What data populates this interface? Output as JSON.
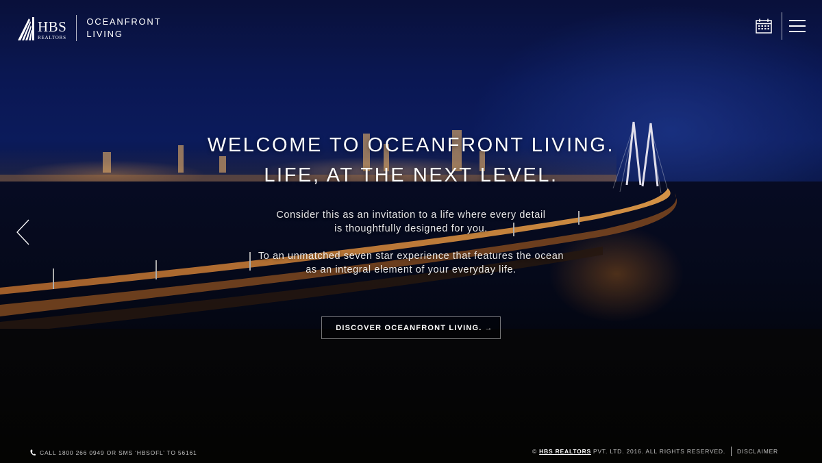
{
  "brand": {
    "logo_name": "HBS",
    "logo_sub": "REALTORS",
    "tagline_line1": "OCEANFRONT",
    "tagline_line2": "LIVING"
  },
  "header": {
    "calendar_icon": "calendar-icon",
    "menu_icon": "hamburger-menu-icon"
  },
  "hero": {
    "heading_line1": "WELCOME TO OCEANFRONT LIVING.",
    "heading_line2": "LIFE, AT THE NEXT LEVEL.",
    "para1_line1": "Consider this as an invitation to a life where every detail",
    "para1_line2": "is thoughtfully designed for you.",
    "para2_line1": "To an unmatched seven star experience that features the ocean",
    "para2_line2": "as an integral element of your everyday life.",
    "cta_label": "DISCOVER OCEANFRONT LIVING.",
    "cta_arrow": "→"
  },
  "carousel": {
    "prev_icon": "chevron-left-icon"
  },
  "footer": {
    "contact": "CALL 1800 266 0949 OR SMS ‘HBSOFL’ TO 56161",
    "copyright_prefix": "©",
    "copyright_brand": "HBS REALTORS",
    "copyright_suffix": "PVT. LTD. 2016. ALL RIGHTS RESERVED.",
    "disclaimer": "DISCLAIMER"
  },
  "colors": {
    "sky_top": "#0a1240",
    "sky_mid": "#0d1e63",
    "bridge_light": "#f0a040"
  }
}
